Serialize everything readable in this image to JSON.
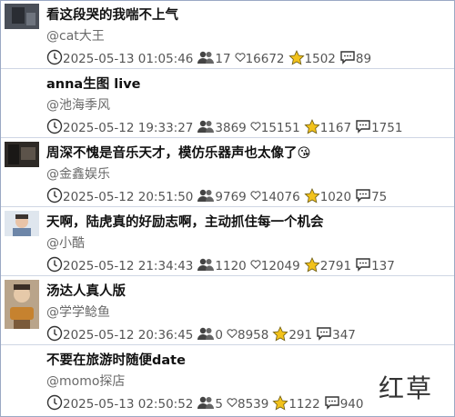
{
  "videos": [
    {
      "title": "看这段哭的我喘不上气",
      "author": "@cat大王",
      "date": "2025-05-13 01:05:46",
      "views": "17",
      "likes": "16672",
      "favorites": "1502",
      "comments": "89",
      "thumb": "dark"
    },
    {
      "title": "anna生图 live",
      "author": "@池海季风",
      "date": "2025-05-12 19:33:27",
      "views": "3869",
      "likes": "15151",
      "favorites": "1167",
      "comments": "1751",
      "thumb": "none"
    },
    {
      "title": "周深不愧是音乐天才，模仿乐器声也太像了😘",
      "author": "@金鑫娱乐",
      "date": "2025-05-12 20:51:50",
      "views": "9769",
      "likes": "14076",
      "favorites": "1020",
      "comments": "75",
      "thumb": "dark"
    },
    {
      "title": "天啊，陆虎真的好励志啊，主动抓住每一个机会",
      "author": "@小酷",
      "date": "2025-05-12 21:34:43",
      "views": "1120",
      "likes": "12049",
      "favorites": "2791",
      "comments": "137",
      "thumb": "person"
    },
    {
      "title": "汤达人真人版",
      "author": "@学学鲶鱼",
      "date": "2025-05-12 20:36:45",
      "views": "0",
      "likes": "8958",
      "favorites": "291",
      "comments": "347",
      "thumb": "food"
    },
    {
      "title": "不要在旅游时随便date",
      "author": "@momo探店",
      "date": "2025-05-13 02:50:52",
      "views": "5",
      "likes": "8539",
      "favorites": "1122",
      "comments": "940",
      "thumb": "none"
    }
  ],
  "watermark": "红草",
  "colors": {
    "border": "#9aa8c4",
    "star": "#f2c21b",
    "text_muted": "#555555"
  }
}
